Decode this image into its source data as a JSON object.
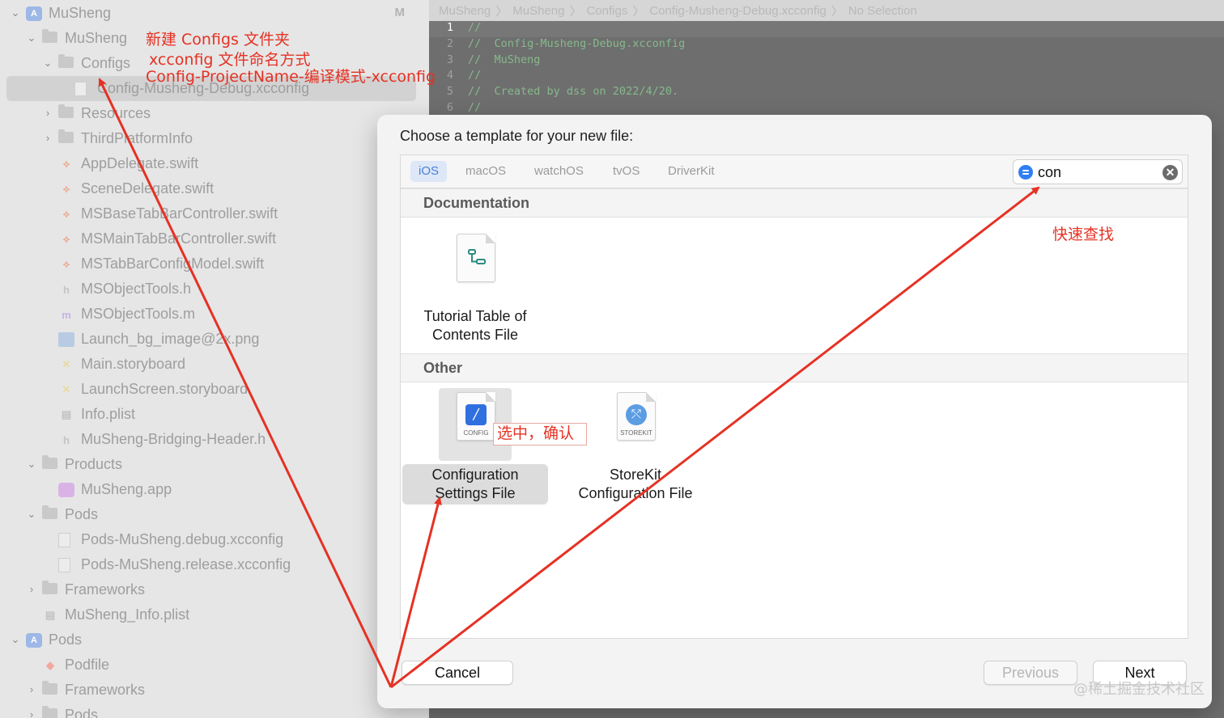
{
  "navigator": {
    "rows": [
      {
        "label": "MuSheng",
        "icon": "project-icon",
        "kind": "proj",
        "chev": "down",
        "indent": 0
      },
      {
        "label": "MuSheng",
        "icon": "folder-icon",
        "kind": "folder",
        "chev": "down",
        "indent": 1
      },
      {
        "label": "Configs",
        "icon": "folder-icon",
        "kind": "folder",
        "chev": "down",
        "indent": 2
      },
      {
        "label": "Config-Musheng-Debug.xcconfig",
        "icon": "xcconfig-file-icon",
        "kind": "xcc",
        "chev": "",
        "indent": 3,
        "selected": true
      },
      {
        "label": "Resources",
        "icon": "folder-icon",
        "kind": "folder",
        "chev": "right",
        "indent": 2
      },
      {
        "label": "ThirdPlatformInfo",
        "icon": "folder-icon",
        "kind": "folder",
        "chev": "right",
        "indent": 2
      },
      {
        "label": "AppDelegate.swift",
        "icon": "swift-file-icon",
        "kind": "swift",
        "chev": "",
        "indent": 2
      },
      {
        "label": "SceneDelegate.swift",
        "icon": "swift-file-icon",
        "kind": "swift",
        "chev": "",
        "indent": 2
      },
      {
        "label": "MSBaseTabBarController.swift",
        "icon": "swift-file-icon",
        "kind": "swift",
        "chev": "",
        "indent": 2
      },
      {
        "label": "MSMainTabBarController.swift",
        "icon": "swift-file-icon",
        "kind": "swift",
        "chev": "",
        "indent": 2
      },
      {
        "label": "MSTabBarConfigModel.swift",
        "icon": "swift-file-icon",
        "kind": "swift",
        "chev": "",
        "indent": 2
      },
      {
        "label": "MSObjectTools.h",
        "icon": "header-file-icon",
        "kind": "hfile",
        "chev": "",
        "indent": 2
      },
      {
        "label": "MSObjectTools.m",
        "icon": "objc-file-icon",
        "kind": "mfile",
        "chev": "",
        "indent": 2
      },
      {
        "label": "Launch_bg_image@2x.png",
        "icon": "image-file-icon",
        "kind": "png",
        "chev": "",
        "indent": 2
      },
      {
        "label": "Main.storyboard",
        "icon": "storyboard-icon",
        "kind": "sb",
        "chev": "",
        "indent": 2
      },
      {
        "label": "LaunchScreen.storyboard",
        "icon": "storyboard-icon",
        "kind": "sb",
        "chev": "",
        "indent": 2
      },
      {
        "label": "Info.plist",
        "icon": "plist-icon",
        "kind": "plist",
        "chev": "",
        "indent": 2
      },
      {
        "label": "MuSheng-Bridging-Header.h",
        "icon": "header-file-icon",
        "kind": "hfile",
        "chev": "",
        "indent": 2
      },
      {
        "label": "Products",
        "icon": "folder-icon",
        "kind": "folder",
        "chev": "down",
        "indent": 1
      },
      {
        "label": "MuSheng.app",
        "icon": "app-icon",
        "kind": "app",
        "chev": "",
        "indent": 2
      },
      {
        "label": "Pods",
        "icon": "folder-icon",
        "kind": "folder",
        "chev": "down",
        "indent": 1
      },
      {
        "label": "Pods-MuSheng.debug.xcconfig",
        "icon": "xcconfig-file-icon",
        "kind": "xcc",
        "chev": "",
        "indent": 2
      },
      {
        "label": "Pods-MuSheng.release.xcconfig",
        "icon": "xcconfig-file-icon",
        "kind": "xcc",
        "chev": "",
        "indent": 2
      },
      {
        "label": "Frameworks",
        "icon": "folder-icon",
        "kind": "folder",
        "chev": "right",
        "indent": 1
      },
      {
        "label": "MuSheng_Info.plist",
        "icon": "plist-icon",
        "kind": "plist",
        "chev": "",
        "indent": 1
      },
      {
        "label": "Pods",
        "icon": "project-icon",
        "kind": "proj",
        "chev": "down",
        "indent": 0
      },
      {
        "label": "Podfile",
        "icon": "ruby-file-icon",
        "kind": "ruby",
        "chev": "",
        "indent": 1
      },
      {
        "label": "Frameworks",
        "icon": "folder-icon",
        "kind": "folder",
        "chev": "right",
        "indent": 1
      },
      {
        "label": "Pods",
        "icon": "folder-icon",
        "kind": "folder",
        "chev": "right",
        "indent": 1
      }
    ],
    "badge": "M"
  },
  "jumpbar": [
    "MuSheng",
    "〉",
    "MuSheng",
    "〉",
    "Configs",
    "〉",
    "Config-Musheng-Debug.xcconfig",
    "〉",
    "No Selection"
  ],
  "code": [
    {
      "n": "1",
      "text": "//"
    },
    {
      "n": "2",
      "text": "//  Config-Musheng-Debug.xcconfig"
    },
    {
      "n": "3",
      "text": "//  MuSheng"
    },
    {
      "n": "4",
      "text": "//"
    },
    {
      "n": "5",
      "text": "//  Created by dss on 2022/4/20."
    },
    {
      "n": "6",
      "text": "//"
    }
  ],
  "sheet": {
    "title": "Choose a template for your new file:",
    "platform_tabs": [
      "iOS",
      "macOS",
      "watchOS",
      "tvOS",
      "DriverKit"
    ],
    "active_tab": "iOS",
    "search": {
      "value": "con",
      "clear_glyph": "✕"
    },
    "sections": {
      "documentation": "Documentation",
      "other": "Other"
    },
    "templates": {
      "toc": {
        "label_1": "Tutorial Table of",
        "label_2": "Contents File"
      },
      "config": {
        "label_1": "Configuration",
        "label_2": "Settings File",
        "caption": "CONFIG",
        "glyph": "/"
      },
      "storekit": {
        "label_1": "StoreKit",
        "label_2": "Configuration File",
        "caption": "STOREKIT",
        "glyph": "⤲"
      }
    },
    "buttons": {
      "cancel": "Cancel",
      "previous": "Previous",
      "next": "Next"
    }
  },
  "annotations": {
    "line1": "新建 Configs 文件夹",
    "line2": "xcconfig 文件命名方式",
    "line3": "Config-ProjectName-编译模式-xcconfig",
    "search_note": "快速查找",
    "select_note": "选中，确认"
  },
  "watermark": "@稀土掘金技术社区",
  "colors": {
    "annotation": "#e53224",
    "accent": "#2f7ef5"
  }
}
